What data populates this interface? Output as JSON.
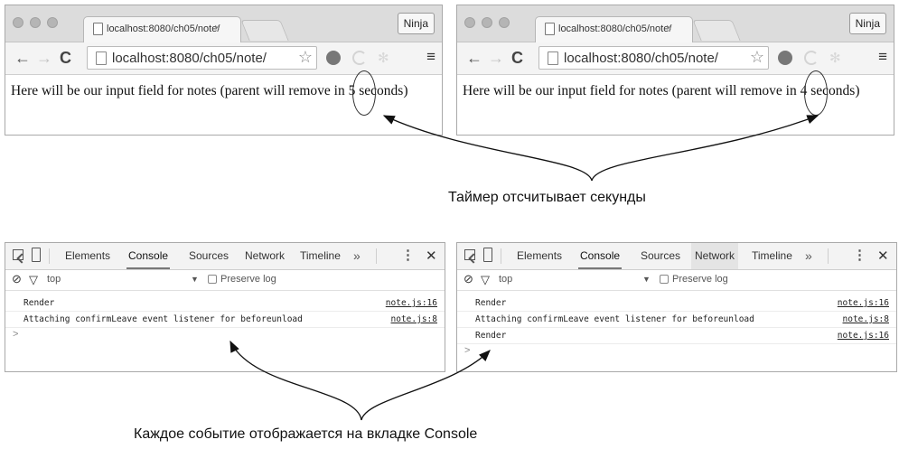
{
  "browsers": [
    {
      "tab_title": "localhost:8080/ch05/note/",
      "tab_close": "×",
      "profile_label": "Ninja",
      "url": "localhost:8080/ch05/note/",
      "content_prefix": "Here will be our input field for notes (parent will remove in ",
      "seconds_value": "5",
      "content_suffix": " seconds)"
    },
    {
      "tab_title": "localhost:8080/ch05/note/",
      "tab_close": "×",
      "profile_label": "Ninja",
      "url": "localhost:8080/ch05/note/",
      "content_prefix": "Here will be our input field for notes (parent will remove in ",
      "seconds_value": "4",
      "content_suffix": " seconds)"
    }
  ],
  "devtools": [
    {
      "tabs": [
        "Elements",
        "Console",
        "Sources",
        "Network",
        "Timeline"
      ],
      "selected_tab": "Console",
      "more_label": "»",
      "kebab_label": "⋮",
      "close_label": "✕",
      "context": "top",
      "preserve_log_label": "Preserve log",
      "logs": [
        {
          "message": "Render",
          "source": "note.js:16"
        },
        {
          "message": "Attaching confirmLeave event listener for beforeunload",
          "source": "note.js:8"
        }
      ],
      "prompt": ">"
    },
    {
      "tabs": [
        "Elements",
        "Console",
        "Sources",
        "Network",
        "Timeline"
      ],
      "selected_tab": "Console",
      "highlighted_tab": "Network",
      "more_label": "»",
      "kebab_label": "⋮",
      "close_label": "✕",
      "context": "top",
      "preserve_log_label": "Preserve log",
      "logs": [
        {
          "message": "Render",
          "source": "note.js:16"
        },
        {
          "message": "Attaching confirmLeave event listener for beforeunload",
          "source": "note.js:8"
        },
        {
          "message": "Render",
          "source": "note.js:16"
        }
      ],
      "prompt": ">"
    }
  ],
  "annotations": {
    "timer_caption": "Таймер отсчитывает секунды",
    "console_caption": "Каждое событие отображается на вкладке Console"
  },
  "icons": [
    "window-dot-icon",
    "page-icon",
    "back-arrow-icon",
    "forward-arrow-icon",
    "reload-icon",
    "bookmark-star-icon",
    "extension-icon",
    "menu-icon",
    "inspect-icon",
    "device-toolbar-icon",
    "clear-console-icon",
    "filter-icon",
    "dropdown-caret-icon"
  ],
  "colors": {
    "chrome_tabstrip": "#dcdcdc",
    "toolbar": "#f4f4f4",
    "devtools_bar": "#f3f3f3"
  }
}
